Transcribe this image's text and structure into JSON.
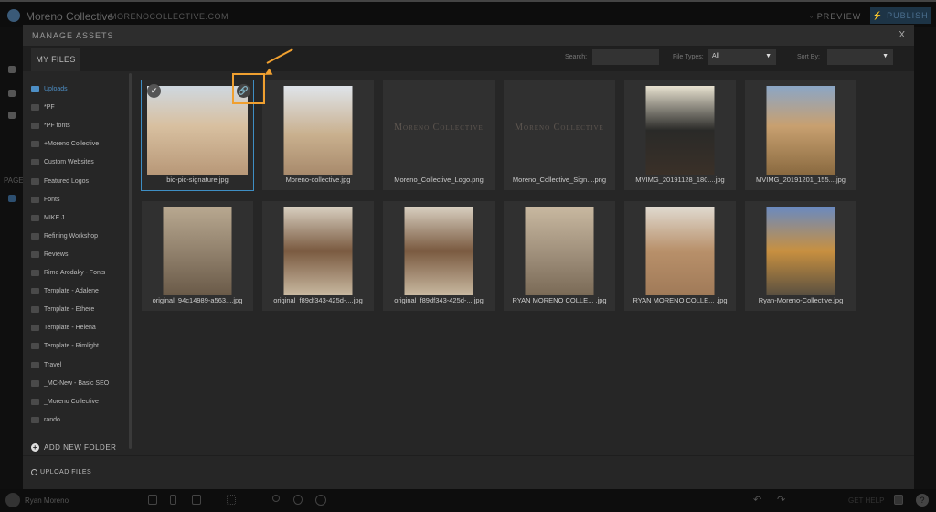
{
  "app": {
    "site_name": "Moreno Collective",
    "domain": "MORENOCOLLECTIVE.COM",
    "preview_label": "PREVIEW",
    "publish_label": "PUBLISH",
    "page_label": "PAGE"
  },
  "modal": {
    "title": "MANAGE ASSETS",
    "close_label": "X",
    "tab": "MY FILES",
    "search": {
      "label": "Search:",
      "value": ""
    },
    "file_types": {
      "label": "File Types:",
      "value": "All"
    },
    "sort_by": {
      "label": "Sort By:",
      "value": ""
    }
  },
  "folders": [
    "Uploads",
    "*PF",
    "*PF fonts",
    "+Moreno Collective",
    "Custom Websites",
    "Featured Logos",
    "Fonts",
    "MIKE J",
    "Refining Workshop",
    "Reviews",
    "Rime Arodaky - Fonts",
    "Template - Adalene",
    "Template - Ethere",
    "Template - Helena",
    "Template - Rimlight",
    "Travel",
    "_MC-New - Basic SEO",
    "_Moreno Collective",
    "rando"
  ],
  "active_folder": "Uploads",
  "add_folder_label": "ADD NEW FOLDER",
  "upload_label": "UPLOAD FILES",
  "files": [
    {
      "name": "bio-pic-signature.jpg",
      "selected": true
    },
    {
      "name": "Moreno-collective.jpg"
    },
    {
      "name": "Moreno_Collective_Logo.png",
      "logo_text": "Moreno Collective"
    },
    {
      "name": "Moreno_Collective_Sign....png",
      "logo_text": "Moreno Collective"
    },
    {
      "name": "MVIMG_20191128_180....jpg"
    },
    {
      "name": "MVIMG_20191201_155....jpg"
    },
    {
      "name": "original_94c14989-a563....jpg"
    },
    {
      "name": "original_f89df343-425d-....jpg"
    },
    {
      "name": "original_f89df343-425d-....jpg"
    },
    {
      "name": "RYAN MORENO COLLE... .jpg"
    },
    {
      "name": "RYAN MORENO COLLE... .jpg"
    },
    {
      "name": "Ryan-Moreno-Collective.jpg"
    }
  ],
  "bottom": {
    "user": "Ryan Moreno",
    "get_help": "GET HELP",
    "help_icon": "?"
  },
  "colors": {
    "accent": "#3e8ec4",
    "highlight": "#f0a030",
    "publish_bg": "#1d3446"
  }
}
